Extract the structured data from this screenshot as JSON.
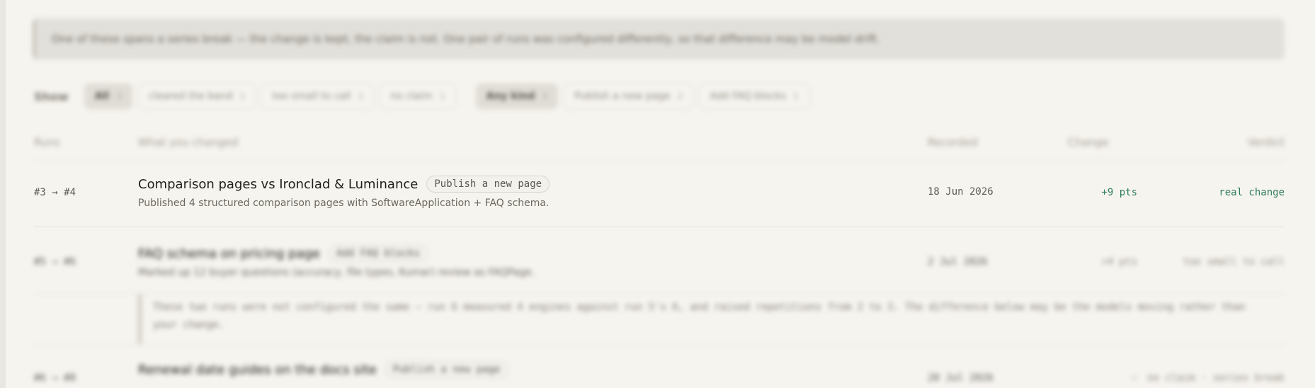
{
  "notice": "One of these spans a series break — the change is kept, the claim is not. One pair of runs was configured differently, so that difference may be model drift.",
  "filters": {
    "show_label": "Show",
    "verdict_chips": [
      {
        "label": "All",
        "count": "3"
      },
      {
        "label": "cleared the band",
        "count": "1"
      },
      {
        "label": "too small to call",
        "count": "1"
      },
      {
        "label": "no claim",
        "count": "1"
      }
    ],
    "kind_chips": [
      {
        "label": "Any kind",
        "count": "3"
      },
      {
        "label": "Publish a new page",
        "count": "2"
      },
      {
        "label": "Add FAQ blocks",
        "count": "1"
      }
    ]
  },
  "table": {
    "columns": {
      "runs": "Runs",
      "what": "What you changed",
      "recorded": "Recorded",
      "change": "Change",
      "verdict": "Verdict"
    },
    "rows": [
      {
        "runs": "#3 → #4",
        "title": "Comparison pages vs Ironclad & Luminance",
        "tag": "Publish a new page",
        "desc": "Published 4 structured comparison pages with SoftwareApplication + FAQ schema.",
        "recorded": "18 Jun 2026",
        "change": "+9 pts",
        "verdict": "real change"
      },
      {
        "runs": "#5 → #6",
        "title": "FAQ schema on pricing page",
        "tag": "Add FAQ blocks",
        "desc": "Marked up 12 buyer questions (accuracy, file types, Kumar) review as FAQPage.",
        "recorded": "2 Jul 2026",
        "change": "+4 pts",
        "verdict": "too small to call"
      },
      {
        "runs": "#6 → #8",
        "title": "Renewal date guides on the docs site",
        "tag": "Publish a new page",
        "desc": "",
        "recorded": "20 Jul 2026",
        "change": "—",
        "verdict": "no claim · series break"
      }
    ],
    "note": "These two runs were not configured the same — run 6 measured 4 engines against run 5's 6, and raised repetitions from 2 to 3. The difference below may be the models moving rather than your change."
  },
  "colors": {
    "positive": "#2e7d5b",
    "muted": "#9e9a90"
  }
}
